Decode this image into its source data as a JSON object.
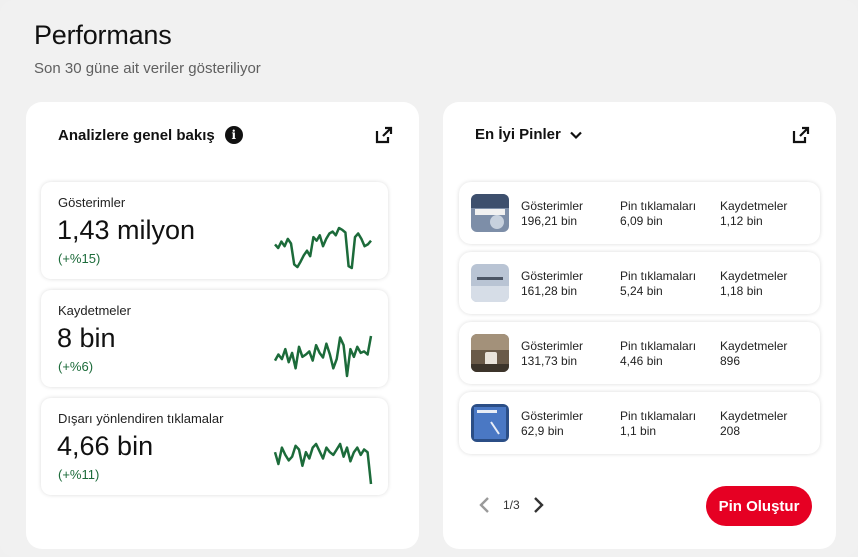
{
  "header": {
    "title": "Performans",
    "subtitle": "Son 30 güne ait veriler gösteriliyor"
  },
  "overview": {
    "title": "Analizlere genel bakış",
    "info_icon": "info-icon",
    "open_icon": "external-link-icon",
    "metrics": [
      {
        "label": "Gösterimler",
        "value": "1,43 milyon",
        "change": "(+%15)",
        "trend": [
          52,
          48,
          55,
          50,
          58,
          53,
          30,
          27,
          33,
          40,
          45,
          39,
          60,
          56,
          62,
          50,
          58,
          64,
          66,
          62,
          70,
          68,
          65,
          28,
          26,
          60,
          64,
          58,
          50,
          52,
          56
        ]
      },
      {
        "label": "Kaydetmeler",
        "value": "8 bin",
        "change": "(+%6)",
        "trend": [
          40,
          48,
          42,
          55,
          38,
          50,
          30,
          58,
          45,
          48,
          52,
          40,
          60,
          50,
          44,
          62,
          48,
          30,
          42,
          70,
          60,
          20,
          55,
          45,
          58,
          50,
          52,
          48,
          72
        ]
      },
      {
        "label": "Dışarı yönlendiren tıklamalar",
        "value": "4,66 bin",
        "change": "(+%11)",
        "trend": [
          55,
          42,
          60,
          52,
          46,
          50,
          62,
          58,
          40,
          55,
          48,
          60,
          64,
          56,
          48,
          60,
          55,
          52,
          58,
          64,
          50,
          60,
          45,
          55,
          60,
          52,
          58,
          55,
          20
        ]
      }
    ],
    "accent_color": "#1c6b3a"
  },
  "top_pins": {
    "title": "En İyi Pinler",
    "dropdown_icon": "chevron-down-icon",
    "open_icon": "external-link-icon",
    "columns": [
      "Gösterimler",
      "Pin tıklamaları",
      "Kaydetmeler"
    ],
    "rows": [
      {
        "impressions": "196,21 bin",
        "clicks": "6,09 bin",
        "saves": "1,12 bin"
      },
      {
        "impressions": "161,28 bin",
        "clicks": "5,24 bin",
        "saves": "1,18 bin"
      },
      {
        "impressions": "131,73 bin",
        "clicks": "4,46 bin",
        "saves": "896"
      },
      {
        "impressions": "62,9 bin",
        "clicks": "1,1 bin",
        "saves": "208"
      }
    ],
    "pagination": {
      "label": "1/3",
      "prev_icon": "chevron-left-icon",
      "next_icon": "chevron-right-icon"
    },
    "create_button": "Pin Oluştur",
    "button_color": "#e60023"
  }
}
